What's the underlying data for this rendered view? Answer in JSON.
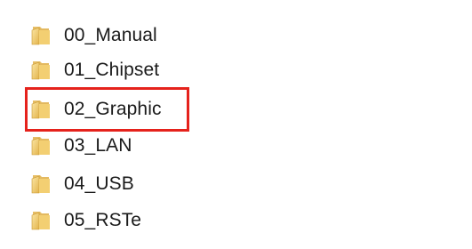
{
  "folders": [
    {
      "name": "00_Manual",
      "icon": "folder-icon"
    },
    {
      "name": "01_Chipset",
      "icon": "folder-icon"
    },
    {
      "name": "02_Graphic",
      "icon": "folder-icon",
      "highlighted": true
    },
    {
      "name": "03_LAN",
      "icon": "folder-icon"
    },
    {
      "name": "04_USB",
      "icon": "folder-icon"
    },
    {
      "name": "05_RSTe",
      "icon": "folder-icon"
    }
  ],
  "colors": {
    "highlight_border": "#e5221c",
    "folder_light": "#f7dc8a",
    "folder_dark": "#d9a93a"
  }
}
